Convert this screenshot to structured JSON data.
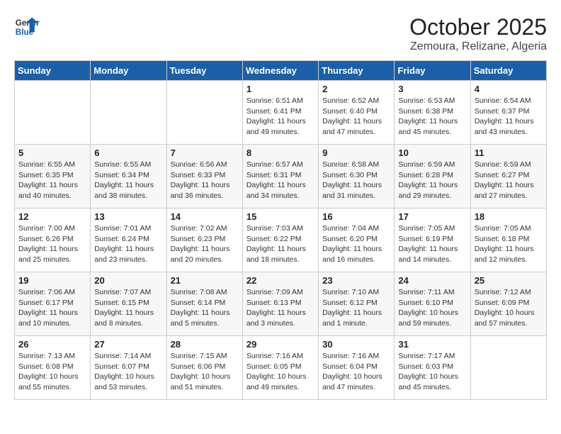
{
  "header": {
    "logo_line1": "General",
    "logo_line2": "Blue",
    "month": "October 2025",
    "location": "Zemoura, Relizane, Algeria"
  },
  "weekdays": [
    "Sunday",
    "Monday",
    "Tuesday",
    "Wednesday",
    "Thursday",
    "Friday",
    "Saturday"
  ],
  "weeks": [
    [
      {
        "day": "",
        "info": ""
      },
      {
        "day": "",
        "info": ""
      },
      {
        "day": "",
        "info": ""
      },
      {
        "day": "1",
        "info": "Sunrise: 6:51 AM\nSunset: 6:41 PM\nDaylight: 11 hours and 49 minutes."
      },
      {
        "day": "2",
        "info": "Sunrise: 6:52 AM\nSunset: 6:40 PM\nDaylight: 11 hours and 47 minutes."
      },
      {
        "day": "3",
        "info": "Sunrise: 6:53 AM\nSunset: 6:38 PM\nDaylight: 11 hours and 45 minutes."
      },
      {
        "day": "4",
        "info": "Sunrise: 6:54 AM\nSunset: 6:37 PM\nDaylight: 11 hours and 43 minutes."
      }
    ],
    [
      {
        "day": "5",
        "info": "Sunrise: 6:55 AM\nSunset: 6:35 PM\nDaylight: 11 hours and 40 minutes."
      },
      {
        "day": "6",
        "info": "Sunrise: 6:55 AM\nSunset: 6:34 PM\nDaylight: 11 hours and 38 minutes."
      },
      {
        "day": "7",
        "info": "Sunrise: 6:56 AM\nSunset: 6:33 PM\nDaylight: 11 hours and 36 minutes."
      },
      {
        "day": "8",
        "info": "Sunrise: 6:57 AM\nSunset: 6:31 PM\nDaylight: 11 hours and 34 minutes."
      },
      {
        "day": "9",
        "info": "Sunrise: 6:58 AM\nSunset: 6:30 PM\nDaylight: 11 hours and 31 minutes."
      },
      {
        "day": "10",
        "info": "Sunrise: 6:59 AM\nSunset: 6:28 PM\nDaylight: 11 hours and 29 minutes."
      },
      {
        "day": "11",
        "info": "Sunrise: 6:59 AM\nSunset: 6:27 PM\nDaylight: 11 hours and 27 minutes."
      }
    ],
    [
      {
        "day": "12",
        "info": "Sunrise: 7:00 AM\nSunset: 6:26 PM\nDaylight: 11 hours and 25 minutes."
      },
      {
        "day": "13",
        "info": "Sunrise: 7:01 AM\nSunset: 6:24 PM\nDaylight: 11 hours and 23 minutes."
      },
      {
        "day": "14",
        "info": "Sunrise: 7:02 AM\nSunset: 6:23 PM\nDaylight: 11 hours and 20 minutes."
      },
      {
        "day": "15",
        "info": "Sunrise: 7:03 AM\nSunset: 6:22 PM\nDaylight: 11 hours and 18 minutes."
      },
      {
        "day": "16",
        "info": "Sunrise: 7:04 AM\nSunset: 6:20 PM\nDaylight: 11 hours and 16 minutes."
      },
      {
        "day": "17",
        "info": "Sunrise: 7:05 AM\nSunset: 6:19 PM\nDaylight: 11 hours and 14 minutes."
      },
      {
        "day": "18",
        "info": "Sunrise: 7:05 AM\nSunset: 6:18 PM\nDaylight: 11 hours and 12 minutes."
      }
    ],
    [
      {
        "day": "19",
        "info": "Sunrise: 7:06 AM\nSunset: 6:17 PM\nDaylight: 11 hours and 10 minutes."
      },
      {
        "day": "20",
        "info": "Sunrise: 7:07 AM\nSunset: 6:15 PM\nDaylight: 11 hours and 8 minutes."
      },
      {
        "day": "21",
        "info": "Sunrise: 7:08 AM\nSunset: 6:14 PM\nDaylight: 11 hours and 5 minutes."
      },
      {
        "day": "22",
        "info": "Sunrise: 7:09 AM\nSunset: 6:13 PM\nDaylight: 11 hours and 3 minutes."
      },
      {
        "day": "23",
        "info": "Sunrise: 7:10 AM\nSunset: 6:12 PM\nDaylight: 11 hours and 1 minute."
      },
      {
        "day": "24",
        "info": "Sunrise: 7:11 AM\nSunset: 6:10 PM\nDaylight: 10 hours and 59 minutes."
      },
      {
        "day": "25",
        "info": "Sunrise: 7:12 AM\nSunset: 6:09 PM\nDaylight: 10 hours and 57 minutes."
      }
    ],
    [
      {
        "day": "26",
        "info": "Sunrise: 7:13 AM\nSunset: 6:08 PM\nDaylight: 10 hours and 55 minutes."
      },
      {
        "day": "27",
        "info": "Sunrise: 7:14 AM\nSunset: 6:07 PM\nDaylight: 10 hours and 53 minutes."
      },
      {
        "day": "28",
        "info": "Sunrise: 7:15 AM\nSunset: 6:06 PM\nDaylight: 10 hours and 51 minutes."
      },
      {
        "day": "29",
        "info": "Sunrise: 7:16 AM\nSunset: 6:05 PM\nDaylight: 10 hours and 49 minutes."
      },
      {
        "day": "30",
        "info": "Sunrise: 7:16 AM\nSunset: 6:04 PM\nDaylight: 10 hours and 47 minutes."
      },
      {
        "day": "31",
        "info": "Sunrise: 7:17 AM\nSunset: 6:03 PM\nDaylight: 10 hours and 45 minutes."
      },
      {
        "day": "",
        "info": ""
      }
    ]
  ]
}
